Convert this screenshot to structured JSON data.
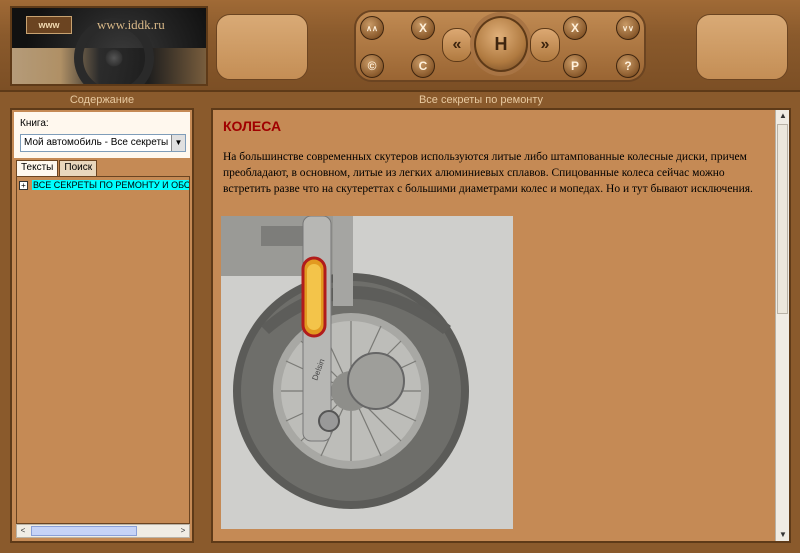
{
  "header": {
    "www_badge": "www",
    "site_url": "www.iddk.ru",
    "nav": {
      "up_label": "∧∧",
      "x_left_label": "X",
      "c_label": "C",
      "copyright_label": "©",
      "prev_label": "«",
      "home_label": "H",
      "next_label": "»",
      "x_right_label": "X",
      "down_label": "∨∨",
      "p_label": "P",
      "help_label": "?"
    }
  },
  "left_panel": {
    "title": "Содержание",
    "book_label": "Книга:",
    "book_selected": "Мой автомобиль - Все секреты по ре",
    "tabs": [
      {
        "label": "Тексты",
        "active": true
      },
      {
        "label": "Поиск",
        "active": false
      }
    ],
    "tree": [
      {
        "label": "ВСЕ СЕКРЕТЫ ПО РЕМОНТУ И ОБСЛ",
        "expander": "+",
        "selected": true
      }
    ],
    "hscroll": {
      "left_arrow": "<",
      "right_arrow": ">"
    }
  },
  "right_panel": {
    "title": "Все секреты по ремонту",
    "article_title": "КОЛЕСА",
    "article_text": "На большинстве современных скутеров используются литые либо штампованные колесные диски, причем преобладают, в основном, литые из легких алюминиевых сплавов. Спицованные колеса сейчас можно встретить разве что на скутереттах с большими диаметрами колес и мопедах. Но и тут бывают исключения.",
    "photo_text": "Delsin",
    "vscroll": {
      "up_arrow": "▲",
      "down_arrow": "▼"
    }
  },
  "colors": {
    "frame": "#8a5a2c",
    "pane": "#c58a55",
    "article_title": "#a00000",
    "tree_highlight": "#00ffff"
  }
}
